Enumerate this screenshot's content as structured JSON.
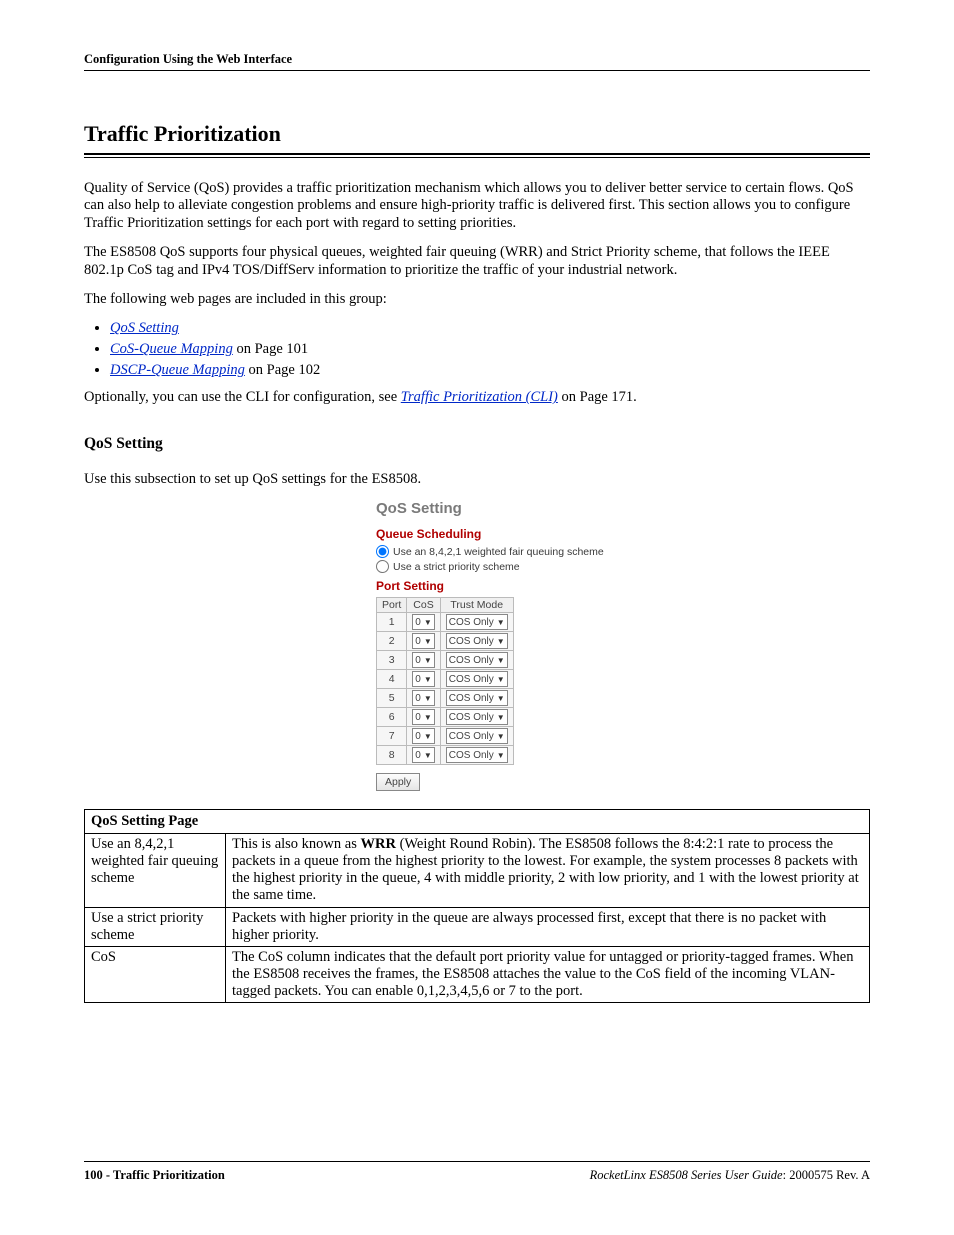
{
  "header": "Configuration Using the Web Interface",
  "title": "Traffic Prioritization",
  "paras": {
    "p1": "Quality of Service (QoS) provides a traffic prioritization mechanism which allows you to deliver better service to certain flows. QoS can also help to alleviate congestion problems and ensure high-priority traffic is delivered first. This section allows you to configure Traffic Prioritization settings for each port with regard to setting priorities.",
    "p2": "The ES8508 QoS supports four physical queues, weighted fair queuing (WRR) and Strict Priority scheme, that follows the IEEE 802.1p CoS tag and IPv4 TOS/DiffServ information to prioritize the traffic of your industrial network.",
    "p3": "The following web pages are included in this group:",
    "p4_prefix": "Optionally, you can use the CLI for configuration, see ",
    "p4_link": "Traffic Prioritization (CLI)",
    "p4_suffix": " on Page 171."
  },
  "links": {
    "l1": "QoS Setting",
    "l2": "CoS-Queue Mapping",
    "l2_suffix": " on Page 101",
    "l3": "DSCP-Queue Mapping",
    "l3_suffix": " on Page 102"
  },
  "h2": "QoS Setting",
  "h2_body": "Use this subsection to set up QoS settings for the ES8508.",
  "screenshot": {
    "title": "QoS Setting",
    "section1": "Queue Scheduling",
    "radio1": "Use an 8,4,2,1 weighted fair queuing scheme",
    "radio2": "Use a strict priority scheme",
    "section2": "Port Setting",
    "cols": {
      "port": "Port",
      "cos": "CoS",
      "trust": "Trust Mode"
    },
    "cos_val": "0",
    "trust_val": "COS Only",
    "ports": [
      "1",
      "2",
      "3",
      "4",
      "5",
      "6",
      "7",
      "8"
    ],
    "apply": "Apply"
  },
  "desc_table": {
    "caption": "QoS Setting Page",
    "rows": [
      {
        "label": "Use an 8,4,2,1 weighted fair queuing scheme",
        "text_pre": "This is also known as ",
        "bold": "WRR",
        "text_post": " (Weight Round Robin). The ES8508 follows the 8:4:2:1 rate to process the packets in a queue from the highest priority to the lowest. For example, the system processes 8 packets with the highest priority in the queue, 4 with middle priority, 2 with low priority, and 1 with the lowest priority at the same time."
      },
      {
        "label": "Use a strict priority scheme",
        "text": "Packets with higher priority in the queue are always processed first, except that there is no packet with higher priority."
      },
      {
        "label": "CoS",
        "text": "The CoS column indicates that the default port priority value for untagged or priority-tagged frames. When the ES8508 receives the frames, the ES8508 attaches the value to the CoS field of the incoming VLAN-tagged packets. You can enable 0,1,2,3,4,5,6 or 7 to the port."
      }
    ]
  },
  "footer": {
    "left": "100 - Traffic Prioritization",
    "right_italic": "RocketLinx ES8508 Series  User Guide",
    "right_plain": ": 2000575 Rev. A"
  }
}
